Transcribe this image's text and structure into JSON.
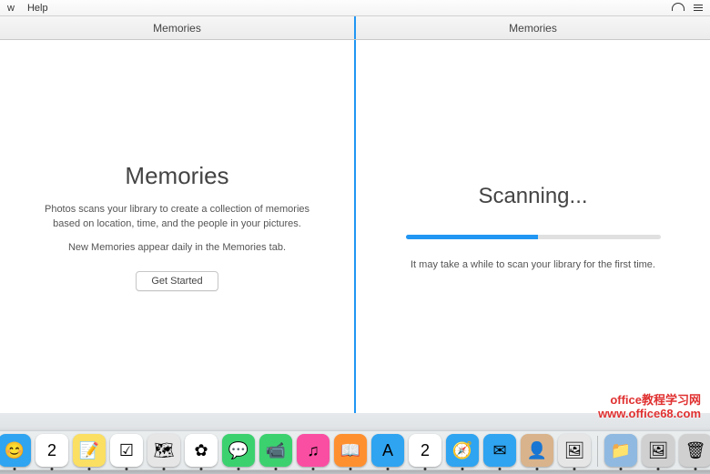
{
  "menubar": {
    "items": [
      "w",
      "Help"
    ]
  },
  "toolbar": {
    "left_title": "Memories",
    "right_title": "Memories"
  },
  "left_pane": {
    "title": "Memories",
    "description": "Photos scans your library to create a collection of memories based on location, time, and the people in your pictures.",
    "subtext": "New Memories appear daily in the Memories tab.",
    "button_label": "Get Started"
  },
  "right_pane": {
    "title": "Scanning...",
    "progress_percent": 52,
    "subtext": "It may take a while to scan your library for the first time."
  },
  "dock": {
    "items": [
      {
        "name": "finder",
        "color": "#2FA4F0",
        "emoji": "😊"
      },
      {
        "name": "calendar-2a",
        "color": "#ffffff",
        "emoji": "2"
      },
      {
        "name": "notes",
        "color": "#FADF63",
        "emoji": "📝"
      },
      {
        "name": "reminders",
        "color": "#ffffff",
        "emoji": "☑"
      },
      {
        "name": "maps",
        "color": "#e6e6e6",
        "emoji": "🗺"
      },
      {
        "name": "photos",
        "color": "#ffffff",
        "emoji": "✿"
      },
      {
        "name": "messages",
        "color": "#3BD16F",
        "emoji": "💬"
      },
      {
        "name": "facetime",
        "color": "#3BD16F",
        "emoji": "📹"
      },
      {
        "name": "itunes",
        "color": "#F94EA2",
        "emoji": "♫"
      },
      {
        "name": "ibooks",
        "color": "#FF9030",
        "emoji": "📖"
      },
      {
        "name": "appstore",
        "color": "#2FA4F0",
        "emoji": "A"
      },
      {
        "name": "calendar-2b",
        "color": "#ffffff",
        "emoji": "2"
      },
      {
        "name": "safari",
        "color": "#2FA4F0",
        "emoji": "🧭"
      },
      {
        "name": "mail",
        "color": "#2FA4F0",
        "emoji": "✉"
      },
      {
        "name": "contacts",
        "color": "#D9B38C",
        "emoji": "👤"
      },
      {
        "name": "preview",
        "color": "#e6e6e6",
        "emoji": "🖼"
      }
    ],
    "right_items": [
      {
        "name": "folder",
        "color": "#8fb9e0",
        "emoji": "📁"
      },
      {
        "name": "screenshot",
        "color": "#d0d0d0",
        "emoji": "🖼"
      },
      {
        "name": "trash",
        "color": "#d0d0d0",
        "emoji": "🗑"
      }
    ]
  },
  "watermark": {
    "line1": "office教程学习网",
    "line2": "www.office68.com"
  }
}
